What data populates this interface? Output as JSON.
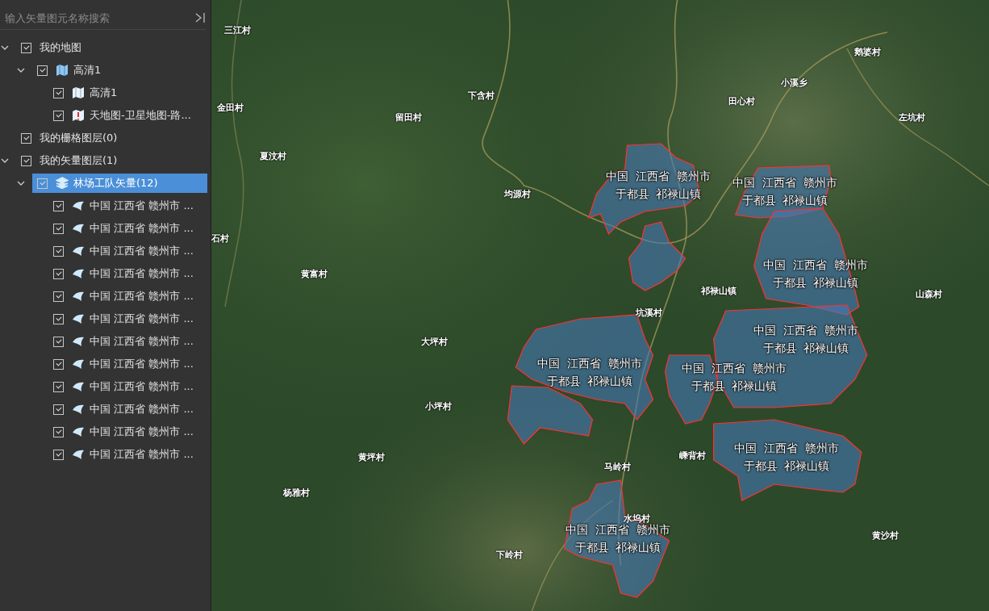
{
  "layer_panel": {
    "search": {
      "placeholder": "输入矢量图元名称搜索"
    },
    "tree": [
      {
        "label": "我的地图",
        "checked": true,
        "expanded": true,
        "selected": false,
        "children": [
          {
            "kind": "map",
            "label": "高清1",
            "checked": true,
            "expanded": true,
            "selected": false,
            "children": [
              {
                "kind": "tile",
                "label": "高清1",
                "checked": true,
                "selected": false
              },
              {
                "kind": "tile-warning",
                "label": "天地图-卫星地图-路...",
                "checked": true,
                "selected": false
              }
            ]
          }
        ]
      },
      {
        "label": "我的栅格图层(0)",
        "checked": true,
        "selected": false
      },
      {
        "label": "我的矢量图层(1)",
        "checked": true,
        "expanded": true,
        "selected": false,
        "children": [
          {
            "kind": "layers",
            "label": "林场工队矢量(12)",
            "checked": true,
            "expanded": true,
            "selected": true,
            "children": [
              {
                "kind": "vector",
                "label": "中国 江西省 赣州市 ...",
                "checked": true,
                "selected": false
              },
              {
                "kind": "vector",
                "label": "中国 江西省 赣州市 ...",
                "checked": true,
                "selected": false
              },
              {
                "kind": "vector",
                "label": "中国 江西省 赣州市 ...",
                "checked": true,
                "selected": false
              },
              {
                "kind": "vector",
                "label": "中国 江西省 赣州市 ...",
                "checked": true,
                "selected": false
              },
              {
                "kind": "vector",
                "label": "中国 江西省 赣州市 ...",
                "checked": true,
                "selected": false
              },
              {
                "kind": "vector",
                "label": "中国 江西省 赣州市 ...",
                "checked": true,
                "selected": false
              },
              {
                "kind": "vector",
                "label": "中国 江西省 赣州市 ...",
                "checked": true,
                "selected": false
              },
              {
                "kind": "vector",
                "label": "中国 江西省 赣州市 ...",
                "checked": true,
                "selected": false
              },
              {
                "kind": "vector",
                "label": "中国 江西省 赣州市 ...",
                "checked": true,
                "selected": false
              },
              {
                "kind": "vector",
                "label": "中国 江西省 赣州市 ...",
                "checked": true,
                "selected": false
              },
              {
                "kind": "vector",
                "label": "中国 江西省 赣州市 ...",
                "checked": true,
                "selected": false
              },
              {
                "kind": "vector",
                "label": "中国 江西省 赣州市 ...",
                "checked": true,
                "selected": false
              }
            ]
          }
        ]
      }
    ]
  },
  "map": {
    "place_labels": [
      "三江村",
      "金田村",
      "夏汶村",
      "石村",
      "黄富村",
      "留田村",
      "下含村",
      "均源村",
      "田心村",
      "小溪乡",
      "鹅婆村",
      "左坑村",
      "祁禄山镇",
      "山森村",
      "坑溪村",
      "大坪村",
      "小坪村",
      "黄坪村",
      "杨雅村",
      "马岭村",
      "嵊背村",
      "水坞村",
      "下岭村",
      "黄沙村"
    ],
    "area_labels": [
      {
        "line_1": "中国  江西省  赣州市",
        "line_2": "于都县  祁禄山镇"
      },
      {
        "line_1": "中国  江西省  赣州市",
        "line_2": "于都县  祁禄山镇"
      },
      {
        "line_1": "中国  江西省  赣州市",
        "line_2": "于都县  祁禄山镇"
      },
      {
        "line_1": "中国  江西省  赣州市",
        "line_2": "于都县  祁禄山镇"
      },
      {
        "line_1": "中国  江西省  赣州市",
        "line_2": "于都县  祁禄山镇"
      },
      {
        "line_1": "中国  江西省  赣州市",
        "line_2": "于都县  祁禄山镇"
      },
      {
        "line_1": "中国  江西省  赣州市",
        "line_2": "于都县  祁禄山镇"
      },
      {
        "line_1": "中国  江西省  赣州市",
        "line_2": "于都县  祁禄山镇"
      }
    ]
  }
}
